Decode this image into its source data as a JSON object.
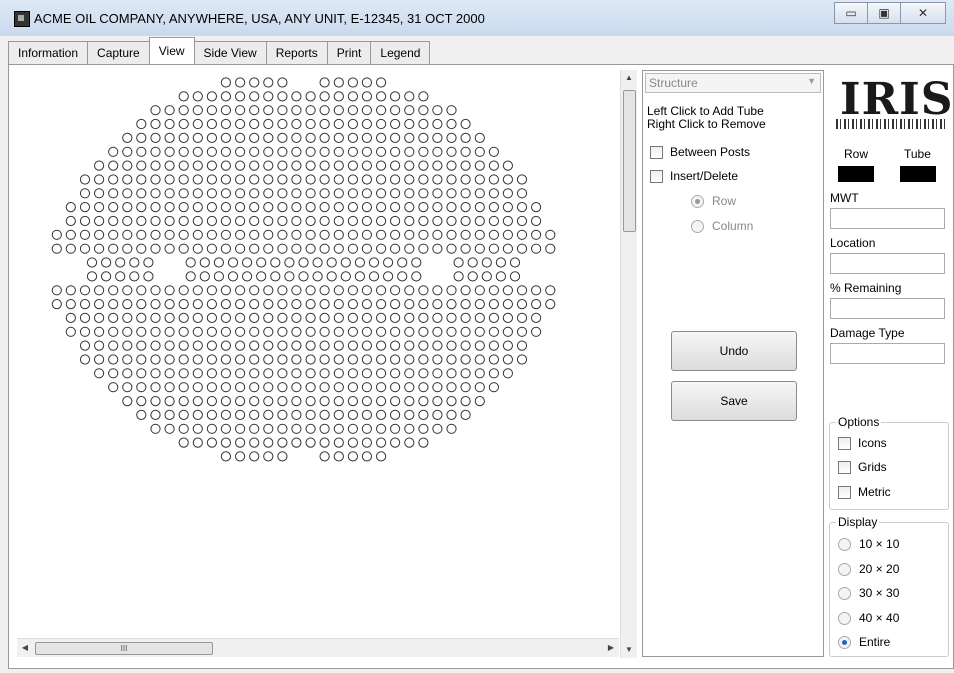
{
  "window": {
    "title": "ACME OIL COMPANY, ANYWHERE, USA,  ANY UNIT, E-12345,  31 OCT 2000",
    "minimize": "▭",
    "maximize": "▣",
    "close": "✕"
  },
  "tabs": [
    {
      "label": "Information"
    },
    {
      "label": "Capture"
    },
    {
      "label": "View",
      "active": true
    },
    {
      "label": "Side View"
    },
    {
      "label": "Reports"
    },
    {
      "label": "Print"
    },
    {
      "label": "Legend"
    }
  ],
  "tube_map": {
    "rows": [
      [
        5,
        5
      ],
      [
        18
      ],
      [
        22
      ],
      [
        24
      ],
      [
        26
      ],
      [
        28
      ],
      [
        30
      ],
      [
        32
      ],
      [
        32
      ],
      [
        34
      ],
      [
        34
      ],
      [
        36
      ],
      [
        36
      ],
      [
        5,
        17,
        5
      ],
      [
        5,
        17,
        5
      ],
      [
        36
      ],
      [
        36
      ],
      [
        34
      ],
      [
        34
      ],
      [
        32
      ],
      [
        32
      ],
      [
        30
      ],
      [
        28
      ],
      [
        26
      ],
      [
        24
      ],
      [
        22
      ],
      [
        18
      ],
      [
        5,
        5
      ]
    ],
    "center_col": 17.5
  },
  "structure": {
    "dropdown_value": "Structure",
    "instructions_line1": "Left Click to Add Tube",
    "instructions_line2": "Right Click to Remove",
    "between_posts": "Between Posts",
    "insert_delete": "Insert/Delete",
    "row_option": "Row",
    "column_option": "Column",
    "undo": "Undo",
    "save": "Save"
  },
  "info": {
    "logo": "IRIS",
    "row_label": "Row",
    "tube_label": "Tube",
    "mwt_label": "MWT",
    "location_label": "Location",
    "remaining_label": "% Remaining",
    "damage_label": "Damage Type"
  },
  "options": {
    "title": "Options",
    "icons": "Icons",
    "grids": "Grids",
    "metric": "Metric"
  },
  "display": {
    "title": "Display",
    "items": [
      "10 × 10",
      "20 × 20",
      "30 × 30",
      "40 × 40",
      "Entire"
    ],
    "selected": "Entire"
  },
  "scroll": {
    "h_thumb_grip": "III"
  },
  "colors": {
    "selected_radio": "#1c64d1",
    "swatch": "#000000"
  }
}
